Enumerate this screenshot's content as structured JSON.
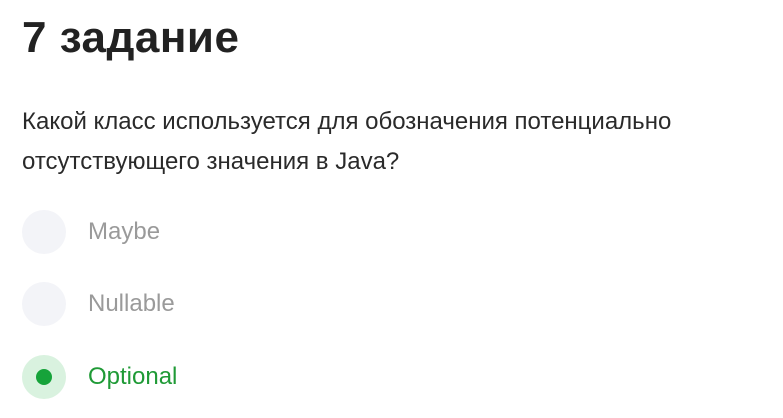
{
  "task": {
    "title": "7 задание",
    "question": "Какой класс используется для обозначения потенциально отсутствующего значения в Java?"
  },
  "options": [
    {
      "label": "Maybe",
      "selected": false
    },
    {
      "label": "Nullable",
      "selected": false
    },
    {
      "label": "Optional",
      "selected": true
    }
  ],
  "colors": {
    "selected_accent": "#16a33a",
    "selected_label": "#1f9a36",
    "selected_radio_bg": "#d9f2df",
    "radio_bg": "#f3f4f8",
    "unselected_label": "#9a9a9a"
  }
}
